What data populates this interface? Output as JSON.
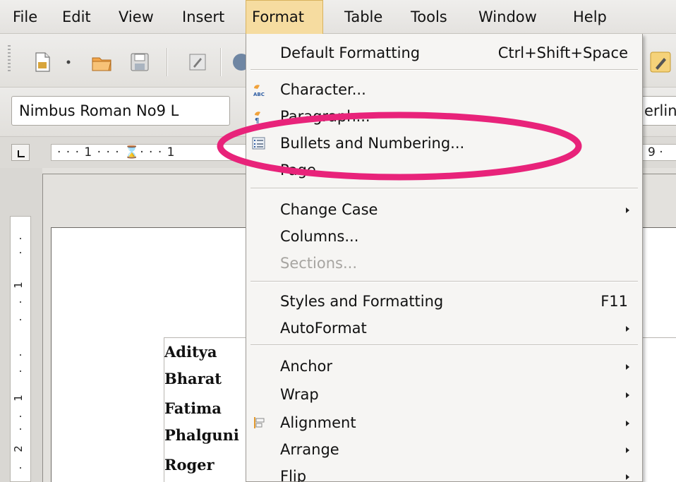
{
  "menubar": {
    "items": [
      {
        "label": "File",
        "mnemonic": "F"
      },
      {
        "label": "Edit",
        "mnemonic": "E"
      },
      {
        "label": "View",
        "mnemonic": "V"
      },
      {
        "label": "Insert",
        "mnemonic": "I"
      },
      {
        "label": "Format",
        "mnemonic": "o",
        "active": true
      },
      {
        "label": "Table",
        "mnemonic": "a"
      },
      {
        "label": "Tools",
        "mnemonic": "T"
      },
      {
        "label": "Window",
        "mnemonic": "W"
      },
      {
        "label": "Help",
        "mnemonic": "H"
      }
    ]
  },
  "formatting": {
    "font_name": "Nimbus Roman No9 L",
    "right_fragment": "erlin"
  },
  "ruler": {
    "text": "· · · 1 · · · ⌛· · · 1",
    "right_text": "9 ·",
    "vertical_marks": [
      "1",
      "1",
      "2"
    ]
  },
  "document": {
    "names": [
      "Aditya",
      "Bharat",
      "Fatima",
      "Phalguni",
      "Roger"
    ]
  },
  "format_menu": {
    "items": [
      {
        "label": "Default Formatting",
        "shortcut": "Ctrl+Shift+Space",
        "icon": null
      },
      {
        "label": "Character...",
        "icon": "character-icon"
      },
      {
        "label": "Paragraph...",
        "icon": "paragraph-icon"
      },
      {
        "label": "Bullets and Numbering...",
        "icon": "bullets-numbering-icon"
      },
      {
        "label": "Page...",
        "icon": null
      },
      {
        "label": "Change Case",
        "submenu": true
      },
      {
        "label": "Columns..."
      },
      {
        "label": "Sections...",
        "disabled": true
      },
      {
        "label": "Styles and Formatting",
        "shortcut": "F11"
      },
      {
        "label": "AutoFormat",
        "submenu": true
      },
      {
        "label": "Anchor",
        "submenu": true
      },
      {
        "label": "Wrap",
        "submenu": true
      },
      {
        "label": "Alignment",
        "submenu": true,
        "icon": "alignment-icon"
      },
      {
        "label": "Arrange",
        "submenu": true
      },
      {
        "label": "Flip",
        "submenu": true
      }
    ]
  },
  "colors": {
    "highlight_ellipse": "#e8237a",
    "active_menu_bg": "#f6dca0"
  }
}
